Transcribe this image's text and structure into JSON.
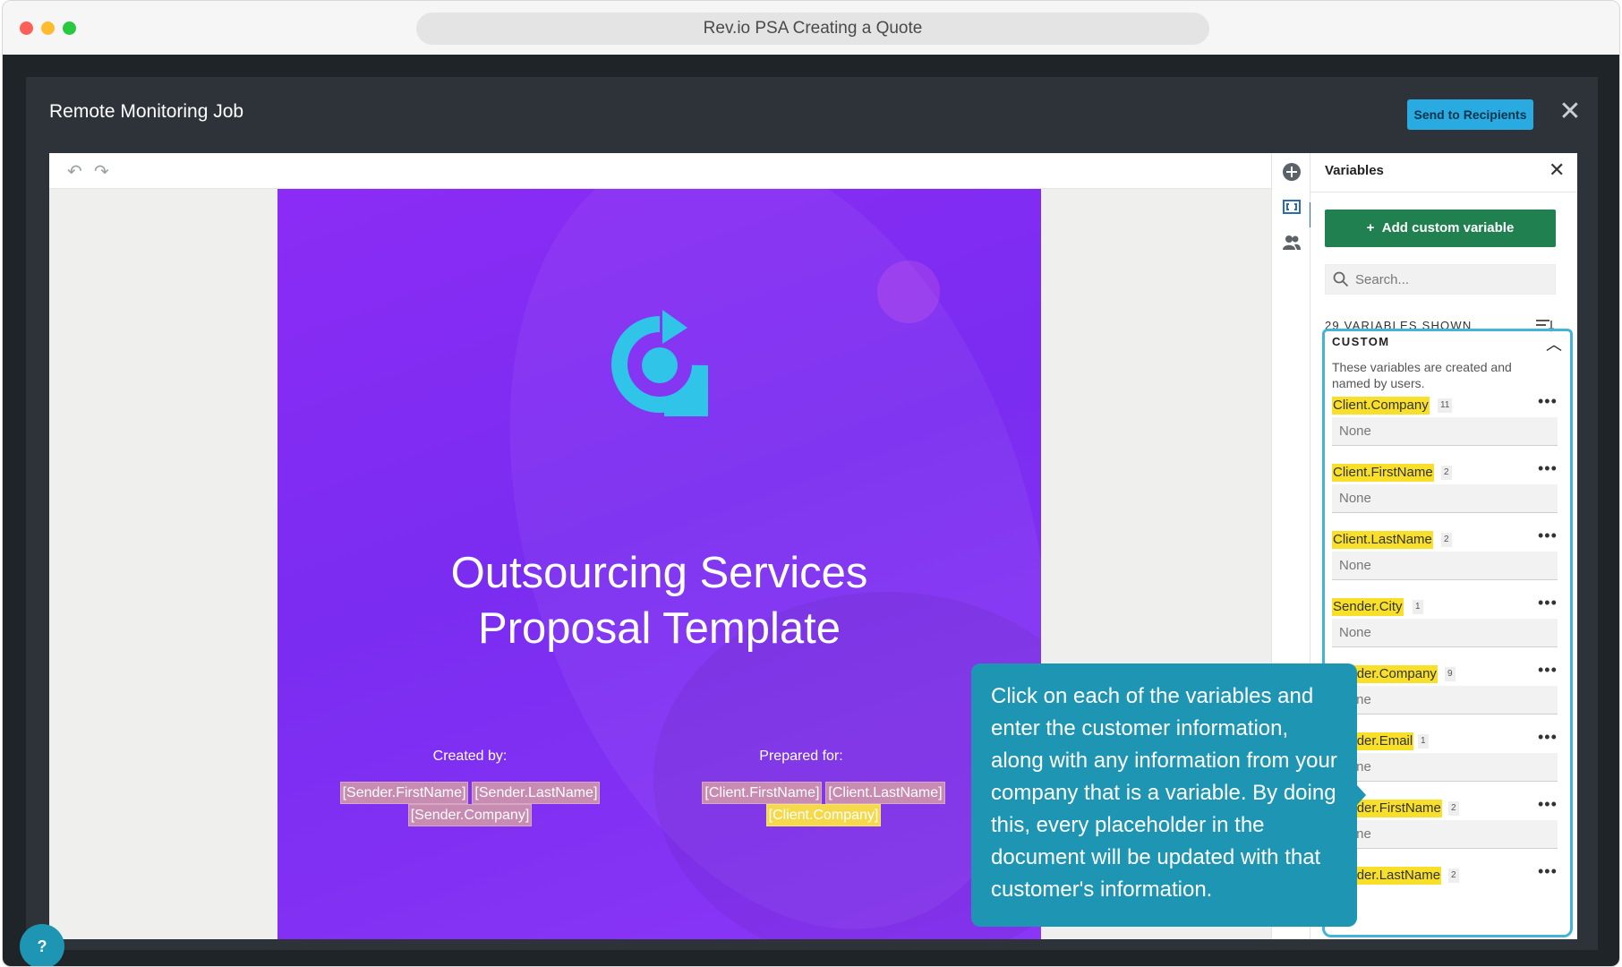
{
  "browser": {
    "title": "Rev.io PSA Creating a Quote"
  },
  "modal": {
    "title": "Remote Monitoring Job",
    "send_label": "Send to Recipients",
    "close_symbol": "✕"
  },
  "toolbar": {
    "undo_symbol": "↶",
    "redo_symbol": "↷"
  },
  "document": {
    "title_line1": "Outsourcing Services",
    "title_line2": "Proposal Template",
    "created_by_label": "Created by:",
    "prepared_for_label": "Prepared for:",
    "sender_tags": [
      "[Sender.FirstName]",
      "[Sender.LastName]",
      "[Sender.Company]"
    ],
    "client_tags": [
      "[Client.FirstName]",
      "[Client.LastName]",
      "[Client.Company]"
    ]
  },
  "panel": {
    "title": "Variables",
    "close_symbol": "✕",
    "add_label": "Add custom variable",
    "search_placeholder": "Search...",
    "shown_label": "29 VARIABLES SHOWN",
    "section_title": "CUSTOM",
    "section_desc": "These variables are created and named by users.",
    "variables": [
      {
        "name": "Client.Company",
        "count": "11",
        "value": "None"
      },
      {
        "name": "Client.FirstName",
        "count": "2",
        "value": "None"
      },
      {
        "name": "Client.LastName",
        "count": "2",
        "value": "None"
      },
      {
        "name": "Sender.City",
        "count": "1",
        "value": "None"
      },
      {
        "name": "Sender.Company",
        "count": "9",
        "value": "None"
      },
      {
        "name": "Sender.Email",
        "count": "1",
        "value": "None"
      },
      {
        "name": "Sender.FirstName",
        "count": "2",
        "value": "None"
      },
      {
        "name": "Sender.LastName",
        "count": "2",
        "value": ""
      }
    ]
  },
  "tooltip": {
    "text": "Click on each of the variables and enter the customer information, along with any information from your company that is a variable. By doing this, every placeholder in the document will be updated with that customer's information."
  },
  "help": {
    "label": "?"
  },
  "colors": {
    "accent": "#29abe2",
    "primary_green": "#21804f",
    "highlight": "#f8df2a",
    "tooltip": "#1e95b3",
    "page_purple": "#8b2cf5"
  }
}
